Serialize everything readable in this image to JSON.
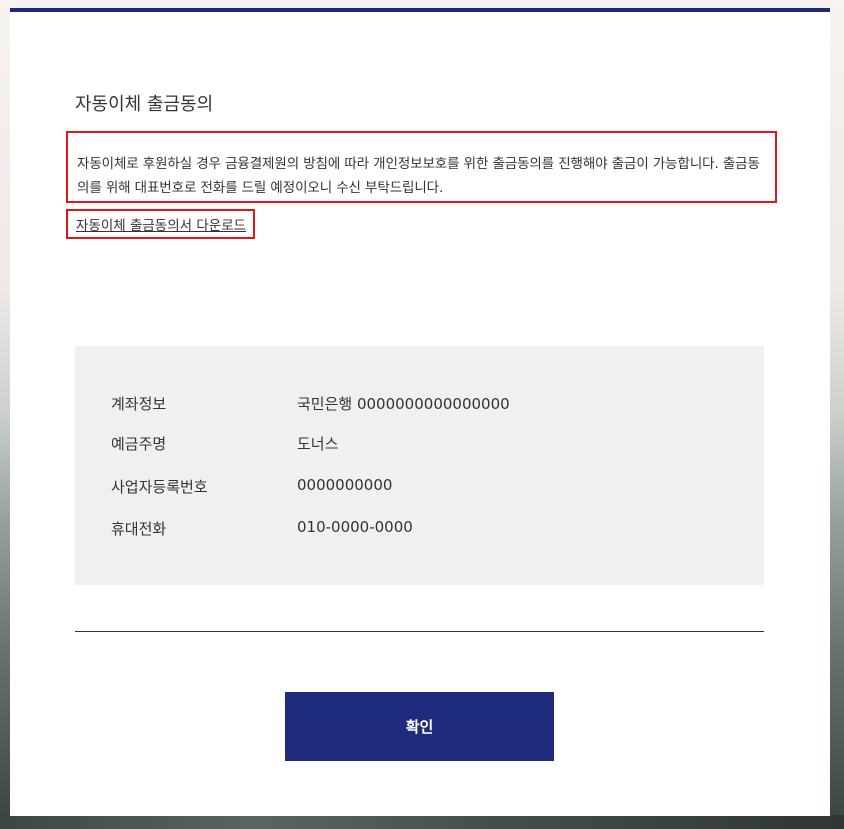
{
  "modal": {
    "title": "자동이체 출금동의",
    "notice": "자동이체로 후원하실 경우 금융결제원의 방침에 따라 개인정보보호를 위한 출금동의를 진행해야 출금이 가능합니다. 출금동의를 위해 대표번호로 전화를 드릴 예정이오니 수신 부탁드립니다.",
    "download_link": "자동이체 출금동의서 다운로드",
    "info": [
      {
        "label": "계좌정보",
        "value": "국민은행 0000000000000000"
      },
      {
        "label": "예금주명",
        "value": "도너스"
      },
      {
        "label": "사업자등록번호",
        "value": "0000000000"
      },
      {
        "label": "휴대전화",
        "value": "010-0000-0000"
      }
    ],
    "confirm_label": "확인"
  },
  "colors": {
    "accent": "#1f2b7b",
    "highlight_border": "#e0161b",
    "info_background": "#f0f0f0"
  }
}
